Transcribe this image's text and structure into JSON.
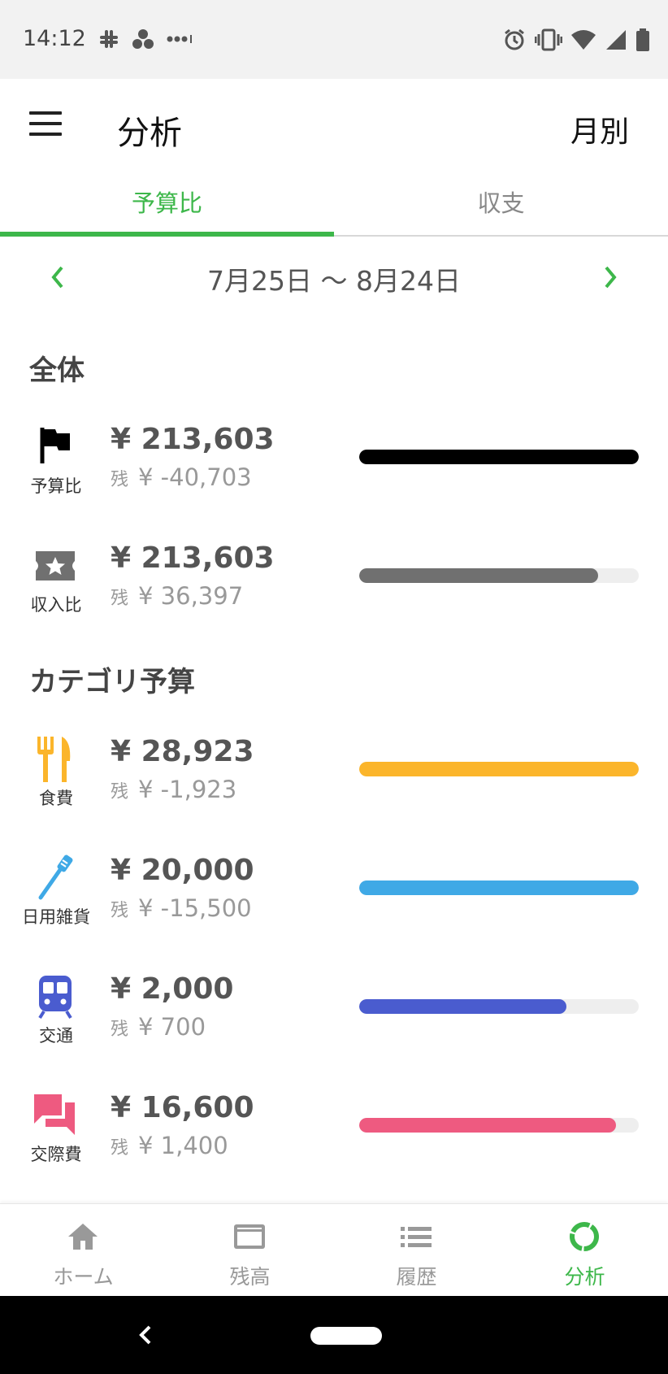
{
  "status_bar": {
    "time": "14:12"
  },
  "app_bar": {
    "title": "分析",
    "period_label": "月別"
  },
  "tabs": [
    {
      "label": "予算比",
      "active": true
    },
    {
      "label": "収支",
      "active": false
    }
  ],
  "date_range": "7月25日 〜 8月24日",
  "overall": {
    "title": "全体",
    "rows": [
      {
        "icon": "flag-icon",
        "label": "予算比",
        "amount": "¥ 213,603",
        "remain_prefix": "残",
        "remain": "¥ -40,703",
        "progress": 1.0,
        "color": "#000000"
      },
      {
        "icon": "ticket-star-icon",
        "label": "収入比",
        "amount": "¥ 213,603",
        "remain_prefix": "残",
        "remain": "¥ 36,397",
        "progress": 0.855,
        "color": "#707070"
      }
    ]
  },
  "category": {
    "title": "カテゴリ予算",
    "rows": [
      {
        "icon": "utensils-icon",
        "label": "食費",
        "amount": "¥ 28,923",
        "remain_prefix": "残",
        "remain": "¥ -1,923",
        "progress": 1.0,
        "color": "#fbb52b"
      },
      {
        "icon": "toothbrush-icon",
        "label": "日用雑貨",
        "amount": "¥ 20,000",
        "remain_prefix": "残",
        "remain": "¥ -15,500",
        "progress": 1.0,
        "color": "#3fa9e6"
      },
      {
        "icon": "train-icon",
        "label": "交通",
        "amount": "¥ 2,000",
        "remain_prefix": "残",
        "remain": "¥ 700",
        "progress": 0.74,
        "color": "#4a5ccf"
      },
      {
        "icon": "chat-bubbles-icon",
        "label": "交際費",
        "amount": "¥ 16,600",
        "remain_prefix": "残",
        "remain": "¥ 1,400",
        "progress": 0.92,
        "color": "#ee5a80"
      }
    ]
  },
  "bottom_nav": [
    {
      "icon": "home-icon",
      "label": "ホーム",
      "active": false
    },
    {
      "icon": "card-icon",
      "label": "残高",
      "active": false
    },
    {
      "icon": "list-icon",
      "label": "履歴",
      "active": false
    },
    {
      "icon": "analysis-ring-icon",
      "label": "分析",
      "active": true
    }
  ],
  "accent_color": "#3db74a"
}
